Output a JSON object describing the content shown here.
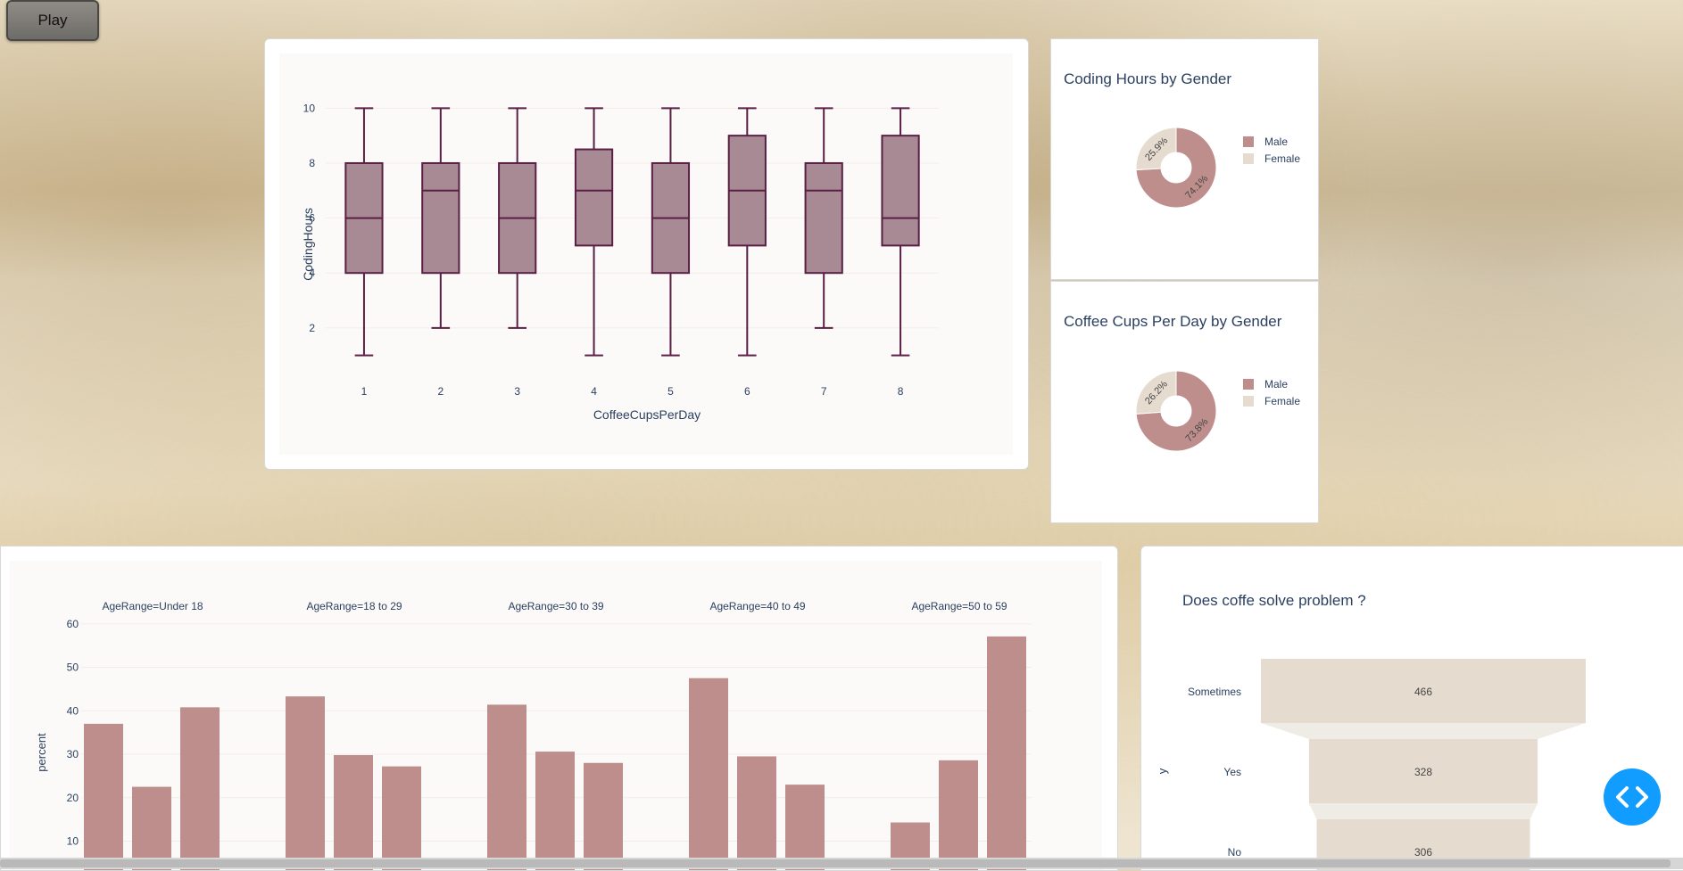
{
  "controls": {
    "play_label": "Play"
  },
  "colors": {
    "male": "#bd8e8c",
    "female": "#e5dccf",
    "box_fill": "#a88a95",
    "box_line": "#5a1f44",
    "accent": "#119dff"
  },
  "box_chart": {
    "chart_data": {
      "type": "box",
      "xlabel": "CoffeeCupsPerDay",
      "ylabel": "CodingHours",
      "categories": [
        "1",
        "2",
        "3",
        "4",
        "5",
        "6",
        "7",
        "8"
      ],
      "yticks": [
        2,
        4,
        6,
        8,
        10
      ],
      "ylim": [
        0.6,
        10.4
      ],
      "boxes": [
        {
          "min": 1,
          "q1": 4,
          "median": 6,
          "q3": 8,
          "max": 10
        },
        {
          "min": 2,
          "q1": 4,
          "median": 7,
          "q3": 8,
          "max": 10
        },
        {
          "min": 2,
          "q1": 4,
          "median": 6,
          "q3": 8,
          "max": 10
        },
        {
          "min": 1,
          "q1": 5,
          "median": 7,
          "q3": 8.5,
          "max": 10
        },
        {
          "min": 1,
          "q1": 4,
          "median": 6,
          "q3": 8,
          "max": 10
        },
        {
          "min": 1,
          "q1": 5,
          "median": 7,
          "q3": 9,
          "max": 10
        },
        {
          "min": 2,
          "q1": 4,
          "median": 7,
          "q3": 8,
          "max": 10
        },
        {
          "min": 1,
          "q1": 5,
          "median": 6,
          "q3": 9,
          "max": 10
        }
      ]
    }
  },
  "donut1": {
    "title": "Coding Hours by Gender",
    "legend": [
      "Male",
      "Female"
    ],
    "chart_data": {
      "type": "pie",
      "labels": [
        "Male",
        "Female"
      ],
      "values": [
        74.1,
        25.9
      ],
      "text": [
        "74.1%",
        "25.9%"
      ]
    }
  },
  "donut2": {
    "title": "Coffee Cups Per Day  by Gender",
    "legend": [
      "Male",
      "Female"
    ],
    "chart_data": {
      "type": "pie",
      "labels": [
        "Male",
        "Female"
      ],
      "values": [
        73.8,
        26.2
      ],
      "text": [
        "73.8%",
        "26.2%"
      ]
    }
  },
  "bar_chart": {
    "chart_data": {
      "type": "bar",
      "ylabel": "percent",
      "yticks": [
        10,
        20,
        30,
        40,
        50,
        60
      ],
      "ylim": [
        6,
        62
      ],
      "facets": [
        {
          "title": "AgeRange=Under 18",
          "values": [
            37,
            22.5,
            40.8
          ]
        },
        {
          "title": "AgeRange=18 to 29",
          "values": [
            43.3,
            29.8,
            27.2
          ]
        },
        {
          "title": "AgeRange=30 to 39",
          "values": [
            41.4,
            30.6,
            28
          ]
        },
        {
          "title": "AgeRange=40 to 49",
          "values": [
            47.5,
            29.5,
            23
          ]
        },
        {
          "title": "AgeRange=50 to 59",
          "values": [
            14.3,
            28.6,
            57.1
          ]
        }
      ]
    }
  },
  "funnel": {
    "title": "Does coffe solve problem ?",
    "ylabel": "y",
    "chart_data": {
      "type": "funnel",
      "labels": [
        "Sometimes",
        "Yes",
        "No"
      ],
      "values": [
        466,
        328,
        306
      ]
    }
  }
}
